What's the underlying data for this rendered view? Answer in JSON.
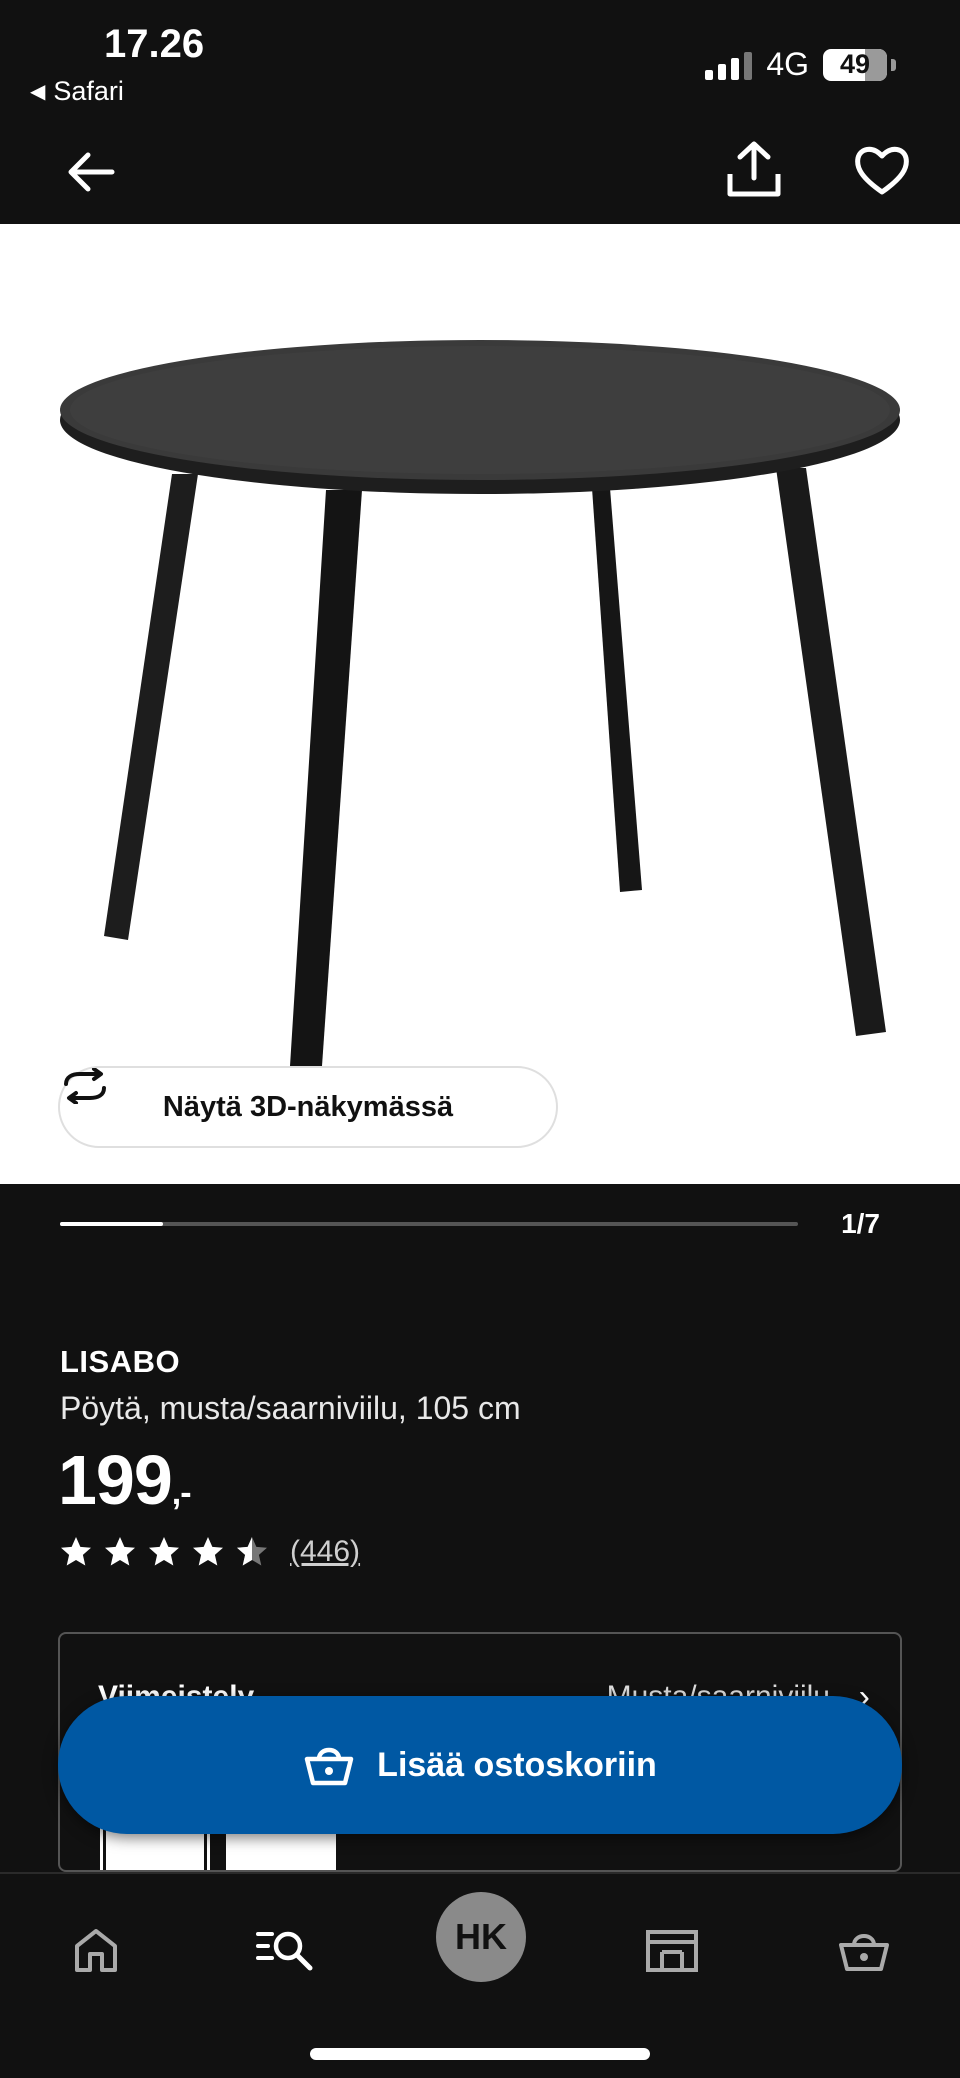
{
  "status_bar": {
    "time": "17.26",
    "back_app": "Safari",
    "network": "4G",
    "battery": "49"
  },
  "nav": {
    "back_icon": "arrow-left-icon",
    "share_icon": "share-icon",
    "favorite_icon": "heart-icon"
  },
  "gallery": {
    "view_3d_label": "Näytä 3D-näkymässä",
    "page_indicator": "1/7",
    "progress": 0.14
  },
  "product": {
    "name": "LISABO",
    "description": "Pöytä, musta/saarniviilu, 105 cm",
    "price": "199",
    "price_suffix": ",-",
    "rating": 4.5,
    "review_count": "(446)"
  },
  "variant": {
    "label": "Viimeistely",
    "value": "Musta/saarniviilu"
  },
  "cta": {
    "add_to_cart_label": "Lisää ostoskoriin"
  },
  "tabbar": {
    "items": [
      "home-icon",
      "search-icon",
      "profile-avatar",
      "store-icon",
      "basket-icon"
    ],
    "avatar_initials": "HK"
  },
  "colors": {
    "background": "#111111",
    "accent": "#0058a3"
  }
}
